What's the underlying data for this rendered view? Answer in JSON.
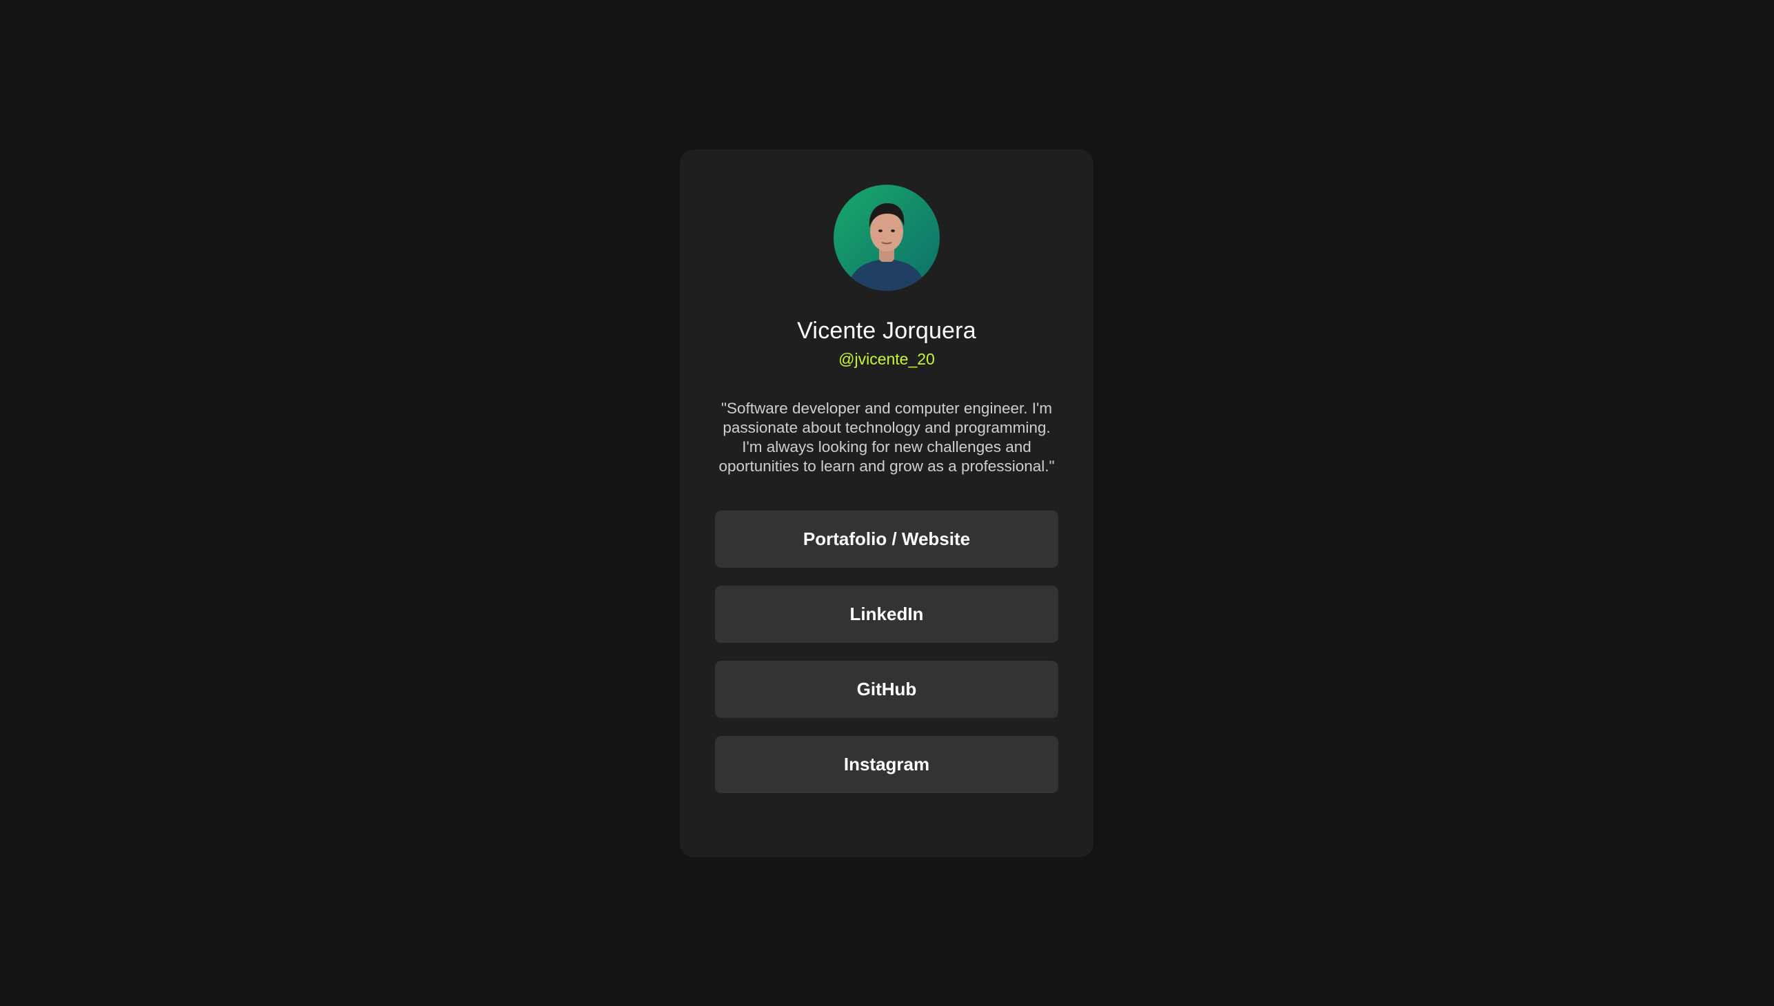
{
  "profile": {
    "name": "Vicente Jorquera",
    "handle": "@jvicente_20",
    "bio": "\"Software developer and computer engineer. I'm passionate about technology and programming. I'm always looking for new challenges and oportunities to learn and grow as a professional.\""
  },
  "links": [
    {
      "label": "Portafolio / Website"
    },
    {
      "label": "LinkedIn"
    },
    {
      "label": "GitHub"
    },
    {
      "label": "Instagram"
    }
  ],
  "colors": {
    "background": "#141414",
    "card": "#1f1f1f",
    "button": "#333333",
    "accent": "#c5f82a"
  }
}
